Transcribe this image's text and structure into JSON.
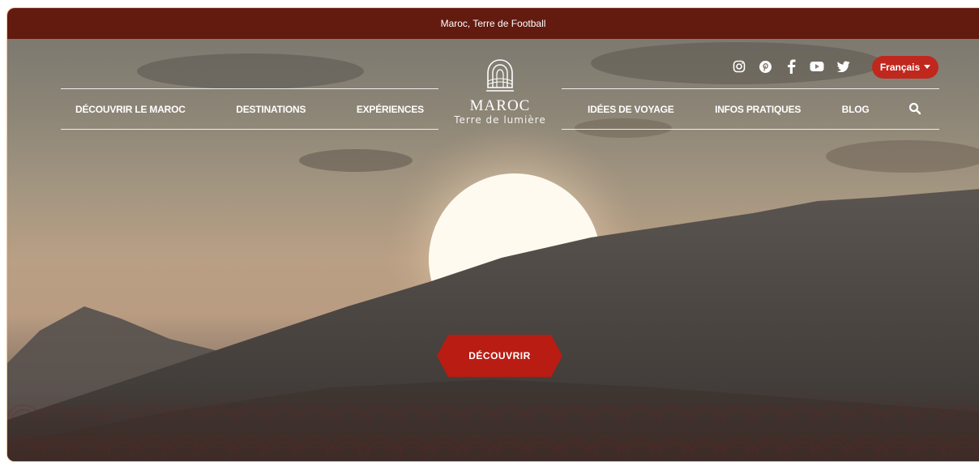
{
  "announcement": {
    "text": "Maroc, Terre de Football"
  },
  "logo": {
    "title": "MAROC",
    "subtitle": "Terre de lumière"
  },
  "nav": {
    "left": [
      {
        "label": "DÉCOUVRIR LE MAROC"
      },
      {
        "label": "DESTINATIONS"
      },
      {
        "label": "EXPÉRIENCES"
      }
    ],
    "right": [
      {
        "label": "IDÉES DE VOYAGE"
      },
      {
        "label": "INFOS PRATIQUES"
      },
      {
        "label": "BLOG"
      }
    ]
  },
  "socials": [
    "instagram-icon",
    "pinterest-icon",
    "facebook-icon",
    "youtube-icon",
    "twitter-icon"
  ],
  "language": {
    "selected": "Français"
  },
  "hero": {
    "cta_label": "DÉCOUVRIR"
  },
  "colors": {
    "brand_dark": "#631a0f",
    "accent": "#c0271d"
  }
}
